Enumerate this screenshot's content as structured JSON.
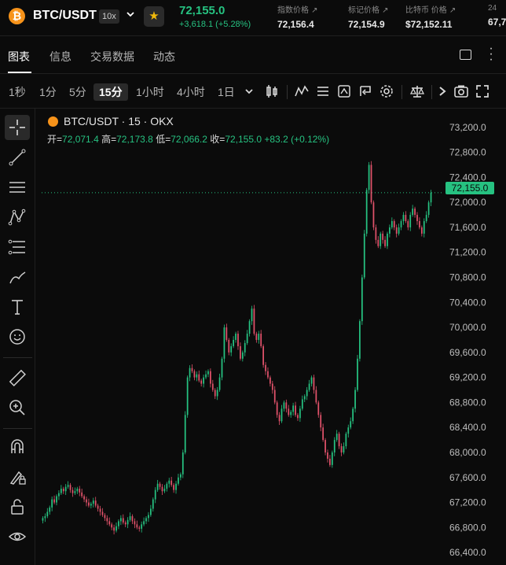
{
  "header": {
    "coin_icon": "bitcoin-icon",
    "coin_glyph": "₿",
    "pair": "BTC/USDT",
    "leverage": "10x",
    "last_price": "72,155.0",
    "change": "+3,618.1 (+5.28%)",
    "stats": [
      {
        "label": "指数价格",
        "value": "72,156.4"
      },
      {
        "label": "标记价格",
        "value": "72,154.9"
      },
      {
        "label": "比特币 价格",
        "value": "$72,152.11"
      },
      {
        "label": "24",
        "value": "67,7"
      }
    ]
  },
  "tabs": [
    "图表",
    "信息",
    "交易数据",
    "动态"
  ],
  "intervals": [
    "1秒",
    "1分",
    "5分",
    "15分",
    "1小时",
    "4小时",
    "1日"
  ],
  "active_interval": "15分",
  "legend": {
    "title": "BTC/USDT · 15 · OKX",
    "open_label": "开",
    "open": "72,071.4",
    "high_label": "高",
    "high": "72,173.8",
    "low_label": "低",
    "low": "72,066.2",
    "close_label": "收",
    "close": "72,155.0",
    "change": "+83.2 (+0.12%)"
  },
  "price_tag": "72,155.0",
  "colors": {
    "up": "#26c281",
    "down": "#e0526a",
    "accent": "#f0b90b"
  },
  "chart_data": {
    "type": "candlestick",
    "title": "BTC/USDT · 15 · OKX",
    "ylim": [
      66200,
      73500
    ],
    "y_ticks": [
      "73,200.0",
      "72,800.0",
      "72,400.0",
      "72,000.0",
      "71,600.0",
      "71,200.0",
      "70,800.0",
      "70,400.0",
      "70,000.0",
      "69,600.0",
      "69,200.0",
      "68,800.0",
      "68,400.0",
      "68,000.0",
      "67,600.0",
      "67,200.0",
      "66,800.0",
      "66,400.0"
    ],
    "y_tick_values": [
      73200,
      72800,
      72400,
      72000,
      71600,
      71200,
      70800,
      70400,
      70000,
      69600,
      69200,
      68800,
      68400,
      68000,
      67600,
      67200,
      66800,
      66400
    ],
    "current_price": 72155.0,
    "closes": [
      66950,
      66980,
      67050,
      67120,
      67250,
      67200,
      67300,
      67350,
      67420,
      67380,
      67450,
      67480,
      67400,
      67350,
      67380,
      67420,
      67360,
      67300,
      67250,
      67200,
      67150,
      67180,
      67230,
      67150,
      67100,
      67050,
      67000,
      66950,
      66900,
      66850,
      66800,
      66750,
      66820,
      66900,
      66950,
      66880,
      66850,
      66920,
      66980,
      66900,
      66850,
      66800,
      66780,
      66850,
      66900,
      66950,
      67000,
      67100,
      67250,
      67400,
      67500,
      67450,
      67380,
      67420,
      67500,
      67550,
      67480,
      67400,
      67500,
      67600,
      67650,
      68000,
      68600,
      69200,
      69350,
      69300,
      69200,
      69250,
      69150,
      69100,
      69200,
      69250,
      69300,
      69100,
      69000,
      68900,
      69000,
      69200,
      69500,
      70000,
      69800,
      69600,
      69700,
      69800,
      69900,
      69700,
      69500,
      69600,
      69750,
      69900,
      70100,
      70300,
      69900,
      69800,
      69900,
      69700,
      69400,
      69300,
      69200,
      69100,
      69000,
      68800,
      68600,
      68500,
      68700,
      68800,
      68700,
      68600,
      68650,
      68750,
      68600,
      68550,
      68700,
      68850,
      68900,
      69000,
      69100,
      69200,
      69000,
      68800,
      68600,
      68400,
      68200,
      68000,
      67900,
      67800,
      68000,
      68200,
      68300,
      68100,
      68000,
      68100,
      68300,
      68400,
      68500,
      68700,
      69000,
      69500,
      70100,
      70800,
      71500,
      72200,
      72600,
      72000,
      71600,
      71400,
      71300,
      71500,
      71400,
      71300,
      71500,
      71600,
      71700,
      71600,
      71500,
      71600,
      71700,
      71800,
      71700,
      71600,
      71800,
      71900,
      71800,
      71700,
      71600,
      71500,
      71700,
      71800,
      72000,
      72155
    ]
  }
}
